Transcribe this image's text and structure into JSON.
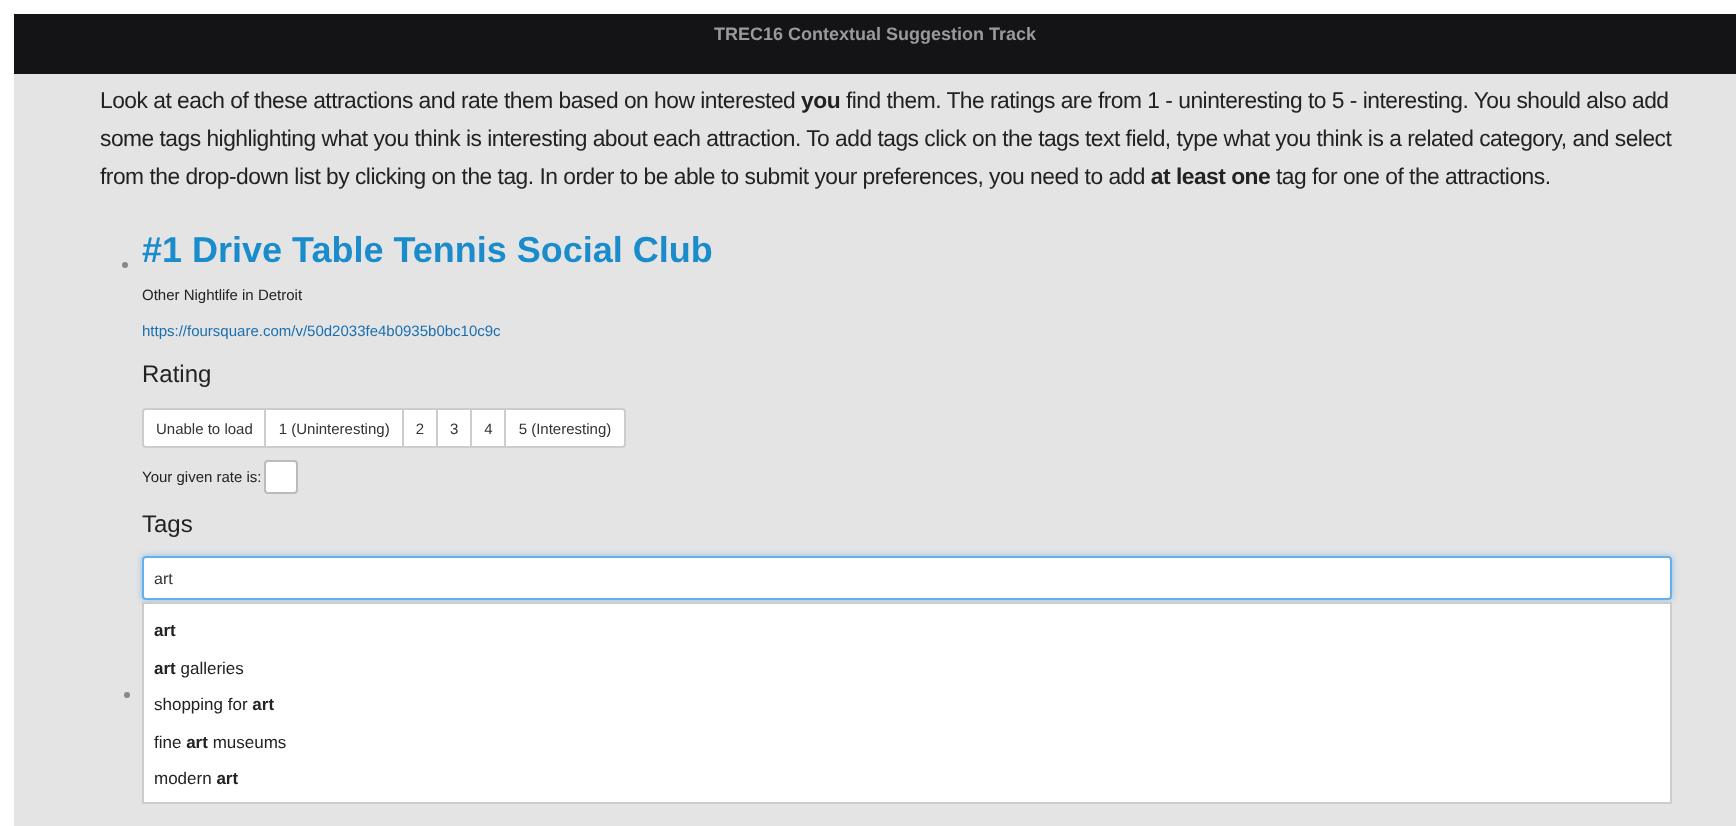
{
  "header": {
    "title": "TREC16 Contextual Suggestion Track"
  },
  "instructions": "Look at each of these attractions and rate them based on how interested **you** find them. The ratings are from 1 - uninteresting to 5 - interesting. You should also add some tags highlighting what you think is interesting about each attraction. To add tags click on the tags text field, type what you think is a related category, and select from the drop-down list by clicking on the tag. In order to be able to submit your preferences, you need to add **at least one** tag for one of the attractions.",
  "attraction": {
    "title": "#1 Drive Table Tennis Social Club",
    "category": "Other Nightlife in Detroit",
    "url": "https://foursquare.com/v/50d2033fe4b0935b0bc10c9c",
    "rating_heading": "Rating",
    "rating_options": [
      {
        "label": "Unable to load",
        "selected": false
      },
      {
        "label": "1 (Uninteresting)",
        "selected": false
      },
      {
        "label": "2",
        "selected": false
      },
      {
        "label": "3",
        "selected": false
      },
      {
        "label": "4",
        "selected": false
      },
      {
        "label": "5 (Interesting)",
        "selected": false
      }
    ],
    "given_rate_label": "Your given rate is:",
    "tags_heading": "Tags",
    "tags_input": {
      "value": "art",
      "focused": true
    },
    "suggestions": [
      {
        "text": "**art**"
      },
      {
        "text": "**art** galleries"
      },
      {
        "text": "shopping for **art**"
      },
      {
        "text": "fine **art** museums"
      },
      {
        "text": "modern **art**"
      }
    ]
  }
}
